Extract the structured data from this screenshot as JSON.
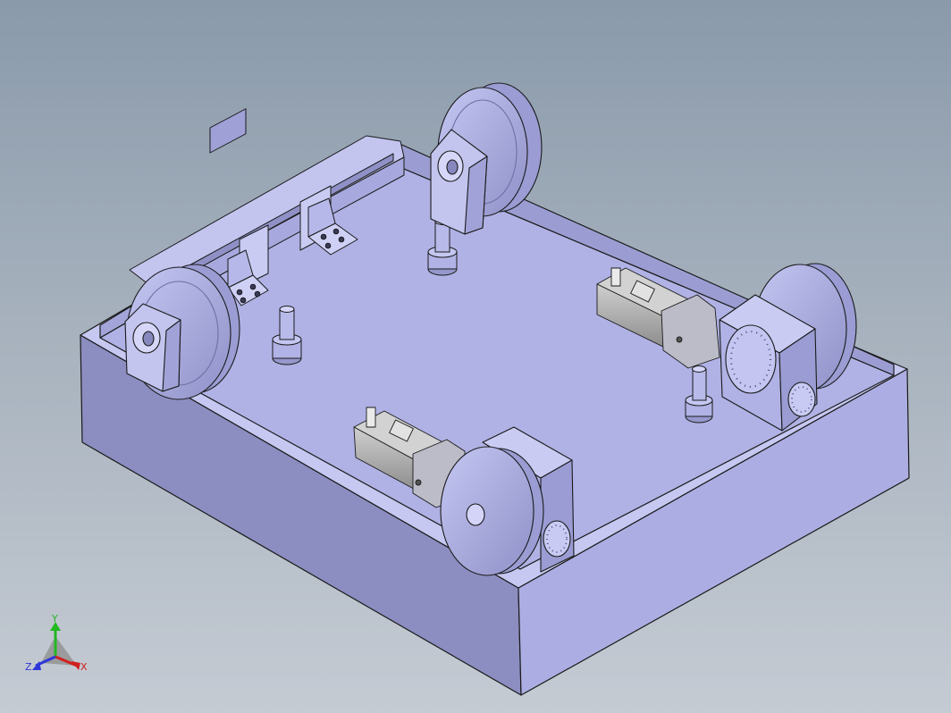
{
  "viewport": {
    "background_top": "#8a9aab",
    "background_bottom": "#c5cbd3"
  },
  "model": {
    "face_color_top": "#b1b3e6",
    "face_color_front": "#8d8fc2",
    "face_color_side": "#a9abe0",
    "edge_color": "#1a1a1a",
    "components": [
      "base-plate",
      "wheel-rear-left",
      "wheel-rear-center",
      "drive-wheel-right",
      "drive-wheel-front",
      "motor-right",
      "motor-front",
      "locating-pin",
      "side-rail",
      "bracket"
    ]
  },
  "triad": {
    "x_label": "X",
    "y_label": "Y",
    "z_label": "Z",
    "x_color": "#d0201e",
    "y_color": "#22b822",
    "z_color": "#2e36d9"
  }
}
